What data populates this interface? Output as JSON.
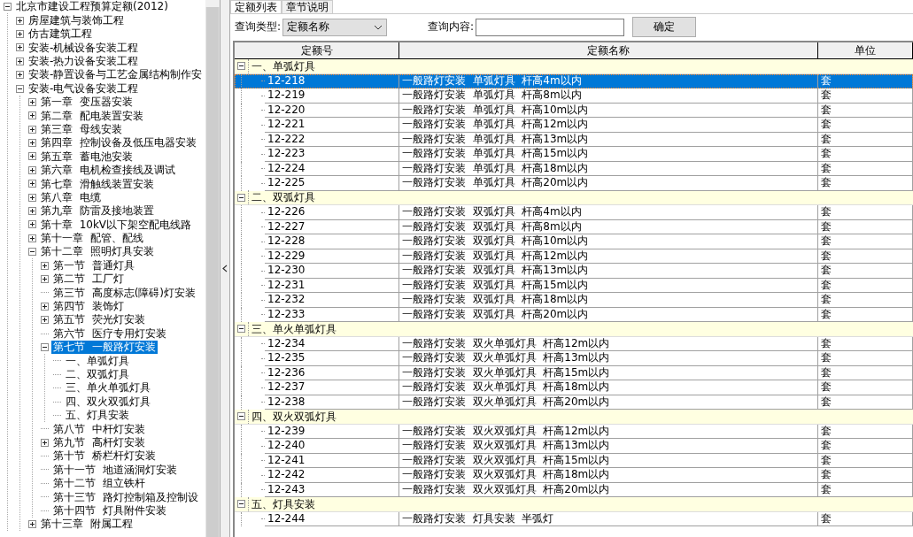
{
  "tree": {
    "label": "北京市建设工程预算定额(2012)",
    "kind": "branch",
    "expanded": true,
    "selected": false,
    "children": [
      {
        "label": "房屋建筑与装饰工程",
        "kind": "branch",
        "expanded": false,
        "selected": false
      },
      {
        "label": "仿古建筑工程",
        "kind": "branch",
        "expanded": false,
        "selected": false
      },
      {
        "label": "安装-机械设备安装工程",
        "kind": "branch",
        "expanded": false,
        "selected": false
      },
      {
        "label": "安装-热力设备安装工程",
        "kind": "branch",
        "expanded": false,
        "selected": false
      },
      {
        "label": "安装-静置设备与工艺金属结构制作安",
        "kind": "branch",
        "expanded": false,
        "selected": false
      },
      {
        "label": "安装-电气设备安装工程",
        "kind": "branch",
        "expanded": true,
        "selected": false,
        "children": [
          {
            "label": "第一章  变压器安装",
            "kind": "branch",
            "expanded": false,
            "selected": false
          },
          {
            "label": "第二章  配电装置安装",
            "kind": "branch",
            "expanded": false,
            "selected": false
          },
          {
            "label": "第三章  母线安装",
            "kind": "branch",
            "expanded": false,
            "selected": false
          },
          {
            "label": "第四章  控制设备及低压电器安装",
            "kind": "branch",
            "expanded": false,
            "selected": false
          },
          {
            "label": "第五章  蓄电池安装",
            "kind": "branch",
            "expanded": false,
            "selected": false
          },
          {
            "label": "第六章  电机检查接线及调试",
            "kind": "branch",
            "expanded": false,
            "selected": false
          },
          {
            "label": "第七章  滑触线装置安装",
            "kind": "branch",
            "expanded": false,
            "selected": false
          },
          {
            "label": "第八章  电缆",
            "kind": "branch",
            "expanded": false,
            "selected": false
          },
          {
            "label": "第九章  防雷及接地装置",
            "kind": "branch",
            "expanded": false,
            "selected": false
          },
          {
            "label": "第十章  10kV以下架空配电线路",
            "kind": "branch",
            "expanded": false,
            "selected": false
          },
          {
            "label": "第十一章  配管、配线",
            "kind": "branch",
            "expanded": false,
            "selected": false
          },
          {
            "label": "第十二章  照明灯具安装",
            "kind": "branch",
            "expanded": true,
            "selected": false,
            "children": [
              {
                "label": "第一节  普通灯具",
                "kind": "branch",
                "expanded": false,
                "selected": false
              },
              {
                "label": "第二节  工厂灯",
                "kind": "branch",
                "expanded": false,
                "selected": false
              },
              {
                "label": "第三节  高度标志(障碍)灯安装",
                "kind": "leaf",
                "selected": false
              },
              {
                "label": "第四节  装饰灯",
                "kind": "branch",
                "expanded": false,
                "selected": false
              },
              {
                "label": "第五节  荧光灯安装",
                "kind": "branch",
                "expanded": false,
                "selected": false
              },
              {
                "label": "第六节  医疗专用灯安装",
                "kind": "leaf",
                "selected": false
              },
              {
                "label": "第七节  一般路灯安装",
                "kind": "branch",
                "expanded": true,
                "selected": true,
                "children": [
                  {
                    "label": "一、单弧灯具",
                    "kind": "leaf",
                    "selected": false
                  },
                  {
                    "label": "二、双弧灯具",
                    "kind": "leaf",
                    "selected": false
                  },
                  {
                    "label": "三、单火单弧灯具",
                    "kind": "leaf",
                    "selected": false
                  },
                  {
                    "label": "四、双火双弧灯具",
                    "kind": "leaf",
                    "selected": false
                  },
                  {
                    "label": "五、灯具安装",
                    "kind": "leaf",
                    "selected": false
                  }
                ]
              },
              {
                "label": "第八节  中杆灯安装",
                "kind": "leaf",
                "selected": false
              },
              {
                "label": "第九节  高杆灯安装",
                "kind": "branch",
                "expanded": false,
                "selected": false
              },
              {
                "label": "第十节  桥栏杆灯安装",
                "kind": "leaf",
                "selected": false
              },
              {
                "label": "第十一节  地道涵洞灯安装",
                "kind": "leaf",
                "selected": false
              },
              {
                "label": "第十二节  组立铁杆",
                "kind": "leaf",
                "selected": false
              },
              {
                "label": "第十三节  路灯控制箱及控制设",
                "kind": "leaf",
                "selected": false
              },
              {
                "label": "第十四节  灯具附件安装",
                "kind": "leaf",
                "selected": false
              }
            ]
          },
          {
            "label": "第十三章  附属工程",
            "kind": "branch",
            "expanded": false,
            "selected": false
          }
        ]
      }
    ]
  },
  "tabs": [
    {
      "label": "定额列表",
      "selected": true
    },
    {
      "label": "章节说明",
      "selected": false
    }
  ],
  "query": {
    "type_label": "查询类型:",
    "type_value": "定额名称",
    "content_label": "查询内容:",
    "button": "确定"
  },
  "table": {
    "columns": [
      "定额号",
      "定额名称",
      "单位"
    ],
    "groups": [
      {
        "label": "一、单弧灯具",
        "expanded": true,
        "rows": [
          {
            "code": "12-218",
            "name": "一般路灯安装  单弧灯具  杆高4m以内",
            "unit": "套",
            "selected": true
          },
          {
            "code": "12-219",
            "name": "一般路灯安装  单弧灯具  杆高8m以内",
            "unit": "套",
            "selected": false
          },
          {
            "code": "12-220",
            "name": "一般路灯安装  单弧灯具  杆高10m以内",
            "unit": "套",
            "selected": false
          },
          {
            "code": "12-221",
            "name": "一般路灯安装  单弧灯具  杆高12m以内",
            "unit": "套",
            "selected": false
          },
          {
            "code": "12-222",
            "name": "一般路灯安装  单弧灯具  杆高13m以内",
            "unit": "套",
            "selected": false
          },
          {
            "code": "12-223",
            "name": "一般路灯安装  单弧灯具  杆高15m以内",
            "unit": "套",
            "selected": false
          },
          {
            "code": "12-224",
            "name": "一般路灯安装  单弧灯具  杆高18m以内",
            "unit": "套",
            "selected": false
          },
          {
            "code": "12-225",
            "name": "一般路灯安装  单弧灯具  杆高20m以内",
            "unit": "套",
            "selected": false
          }
        ]
      },
      {
        "label": "二、双弧灯具",
        "expanded": true,
        "rows": [
          {
            "code": "12-226",
            "name": "一般路灯安装  双弧灯具  杆高4m以内",
            "unit": "套",
            "selected": false
          },
          {
            "code": "12-227",
            "name": "一般路灯安装  双弧灯具  杆高8m以内",
            "unit": "套",
            "selected": false
          },
          {
            "code": "12-228",
            "name": "一般路灯安装  双弧灯具  杆高10m以内",
            "unit": "套",
            "selected": false
          },
          {
            "code": "12-229",
            "name": "一般路灯安装  双弧灯具  杆高12m以内",
            "unit": "套",
            "selected": false
          },
          {
            "code": "12-230",
            "name": "一般路灯安装  双弧灯具  杆高13m以内",
            "unit": "套",
            "selected": false
          },
          {
            "code": "12-231",
            "name": "一般路灯安装  双弧灯具  杆高15m以内",
            "unit": "套",
            "selected": false
          },
          {
            "code": "12-232",
            "name": "一般路灯安装  双弧灯具  杆高18m以内",
            "unit": "套",
            "selected": false
          },
          {
            "code": "12-233",
            "name": "一般路灯安装  双弧灯具  杆高20m以内",
            "unit": "套",
            "selected": false
          }
        ]
      },
      {
        "label": "三、单火单弧灯具",
        "expanded": true,
        "rows": [
          {
            "code": "12-234",
            "name": "一般路灯安装  双火单弧灯具  杆高12m以内",
            "unit": "套",
            "selected": false
          },
          {
            "code": "12-235",
            "name": "一般路灯安装  双火单弧灯具  杆高13m以内",
            "unit": "套",
            "selected": false
          },
          {
            "code": "12-236",
            "name": "一般路灯安装  双火单弧灯具  杆高15m以内",
            "unit": "套",
            "selected": false
          },
          {
            "code": "12-237",
            "name": "一般路灯安装  双火单弧灯具  杆高18m以内",
            "unit": "套",
            "selected": false
          },
          {
            "code": "12-238",
            "name": "一般路灯安装  双火单弧灯具  杆高20m以内",
            "unit": "套",
            "selected": false
          }
        ]
      },
      {
        "label": "四、双火双弧灯具",
        "expanded": true,
        "rows": [
          {
            "code": "12-239",
            "name": "一般路灯安装  双火双弧灯具  杆高12m以内",
            "unit": "套",
            "selected": false
          },
          {
            "code": "12-240",
            "name": "一般路灯安装  双火双弧灯具  杆高13m以内",
            "unit": "套",
            "selected": false
          },
          {
            "code": "12-241",
            "name": "一般路灯安装  双火双弧灯具  杆高15m以内",
            "unit": "套",
            "selected": false
          },
          {
            "code": "12-242",
            "name": "一般路灯安装  双火双弧灯具  杆高18m以内",
            "unit": "套",
            "selected": false
          },
          {
            "code": "12-243",
            "name": "一般路灯安装  双火双弧灯具  杆高20m以内",
            "unit": "套",
            "selected": false
          }
        ]
      },
      {
        "label": "五、灯具安装",
        "expanded": true,
        "rows": [
          {
            "code": "12-244",
            "name": "一般路灯安装  灯具安装  半弧灯",
            "unit": "套",
            "selected": false
          }
        ]
      }
    ]
  }
}
